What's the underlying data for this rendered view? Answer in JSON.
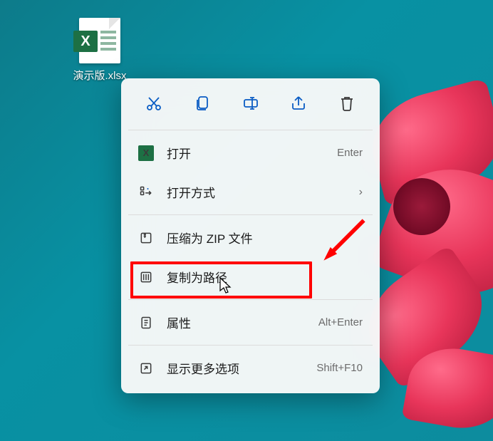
{
  "file": {
    "name": "演示版.xlsx",
    "badge": "X"
  },
  "action_row": {
    "cut": "cut-icon",
    "copy": "copy-icon",
    "rename": "rename-icon",
    "share": "share-icon",
    "delete": "delete-icon"
  },
  "menu": {
    "open": {
      "label": "打开",
      "shortcut": "Enter"
    },
    "open_with": {
      "label": "打开方式"
    },
    "compress_zip": {
      "label": "压缩为 ZIP 文件"
    },
    "copy_as_path": {
      "label": "复制为路径"
    },
    "properties": {
      "label": "属性",
      "shortcut": "Alt+Enter"
    },
    "show_more": {
      "label": "显示更多选项",
      "shortcut": "Shift+F10"
    }
  }
}
